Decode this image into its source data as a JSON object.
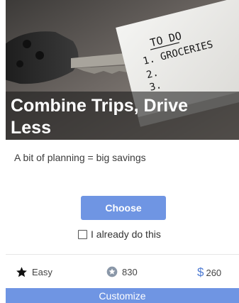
{
  "card": {
    "title": "Combine Trips, Drive Less",
    "subtitle": "A bit of planning = big savings",
    "hero_note": {
      "line1": "TO DO",
      "line2": "1. GROCERIES",
      "line3": "2.",
      "line4": "3."
    },
    "choose_label": "Choose",
    "already_label": "I already do this",
    "already_checked": false,
    "stats": {
      "difficulty": "Easy",
      "points": "830",
      "savings": "$260"
    },
    "customize_label": "Customize"
  },
  "colors": {
    "accent": "#6f95e3",
    "dollar": "#4d7bd3",
    "title_band": "rgba(20,20,20,0.55)"
  },
  "icons": {
    "difficulty": "star-icon",
    "points": "badge-star-icon",
    "savings": "dollar-icon"
  }
}
